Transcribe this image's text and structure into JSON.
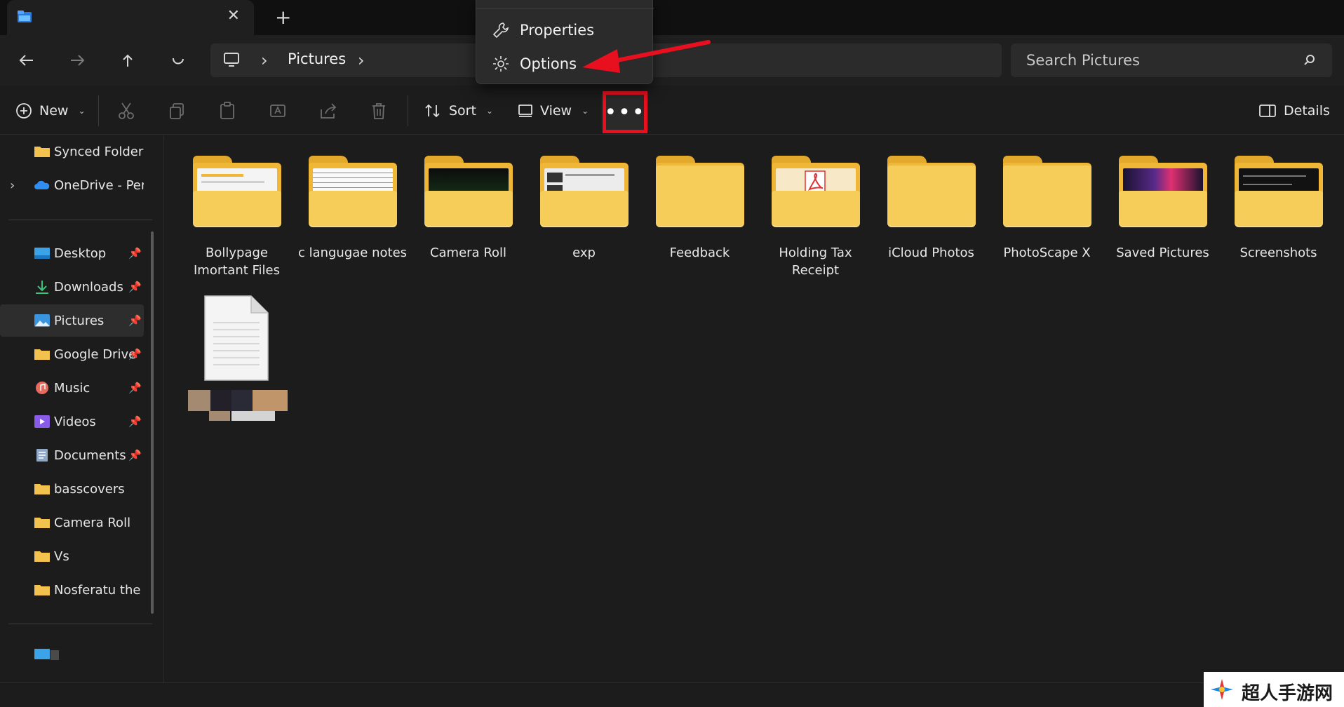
{
  "tab": {
    "close_glyph": "✕",
    "new_tab_glyph": "+"
  },
  "address": {
    "location": "Pictures",
    "chevron": "›"
  },
  "search": {
    "placeholder": "Search Pictures"
  },
  "toolbar": {
    "new_label": "New",
    "sort_label": "Sort",
    "view_label": "View",
    "more_label": "•••",
    "details_label": "Details",
    "chevron": "⌄"
  },
  "context_menu": {
    "items": [
      {
        "label": "Properties",
        "icon": "wrench-icon"
      },
      {
        "label": "Options",
        "icon": "gear-icon"
      }
    ]
  },
  "sidebar": {
    "top": [
      {
        "label": "Synced Folders",
        "icon": "folder-icon"
      },
      {
        "label": "OneDrive - Perso",
        "icon": "onedrive-cloud-icon"
      }
    ],
    "quick_access": [
      {
        "label": "Desktop",
        "icon": "desktop-icon",
        "pinned": true
      },
      {
        "label": "Downloads",
        "icon": "download-arrow-icon",
        "pinned": true
      },
      {
        "label": "Pictures",
        "icon": "pictures-icon",
        "pinned": true,
        "active": true
      },
      {
        "label": "Google Drive",
        "icon": "folder-icon",
        "pinned": true
      },
      {
        "label": "Music",
        "icon": "music-icon",
        "pinned": true
      },
      {
        "label": "Videos",
        "icon": "video-icon",
        "pinned": true
      },
      {
        "label": "Documents",
        "icon": "documents-icon",
        "pinned": true
      },
      {
        "label": "basscovers",
        "icon": "folder-icon",
        "pinned": false
      },
      {
        "label": "Camera Roll",
        "icon": "folder-icon",
        "pinned": false
      },
      {
        "label": "Vs",
        "icon": "folder-icon",
        "pinned": false
      },
      {
        "label": "Nosferatu the Va",
        "icon": "folder-icon",
        "pinned": false
      }
    ],
    "pin_glyph": "📌",
    "expand_glyph": "›"
  },
  "content": {
    "items": [
      {
        "line1": "Bollypage",
        "line2": "Imortant Files",
        "preview": "doc"
      },
      {
        "line1": "c langugae notes",
        "line2": "",
        "preview": "notes"
      },
      {
        "line1": "Camera Roll",
        "line2": "",
        "preview": "dark"
      },
      {
        "line1": "exp",
        "line2": "",
        "preview": "screens"
      },
      {
        "line1": "Feedback",
        "line2": "",
        "preview": "none"
      },
      {
        "line1": "Holding Tax",
        "line2": "Receipt",
        "preview": "pdf"
      },
      {
        "line1": "iCloud Photos",
        "line2": "",
        "preview": "none"
      },
      {
        "line1": "PhotoScape X",
        "line2": "",
        "preview": "none"
      },
      {
        "line1": "Saved Pictures",
        "line2": "",
        "preview": "colorful"
      },
      {
        "line1": "Screenshots",
        "line2": "",
        "preview": "dark-text"
      }
    ]
  },
  "watermark": {
    "text": "超人手游网"
  },
  "colors": {
    "highlight_red": "#e8101e",
    "folder_yellow": "#f7cd5a",
    "background": "#1c1c1c"
  }
}
